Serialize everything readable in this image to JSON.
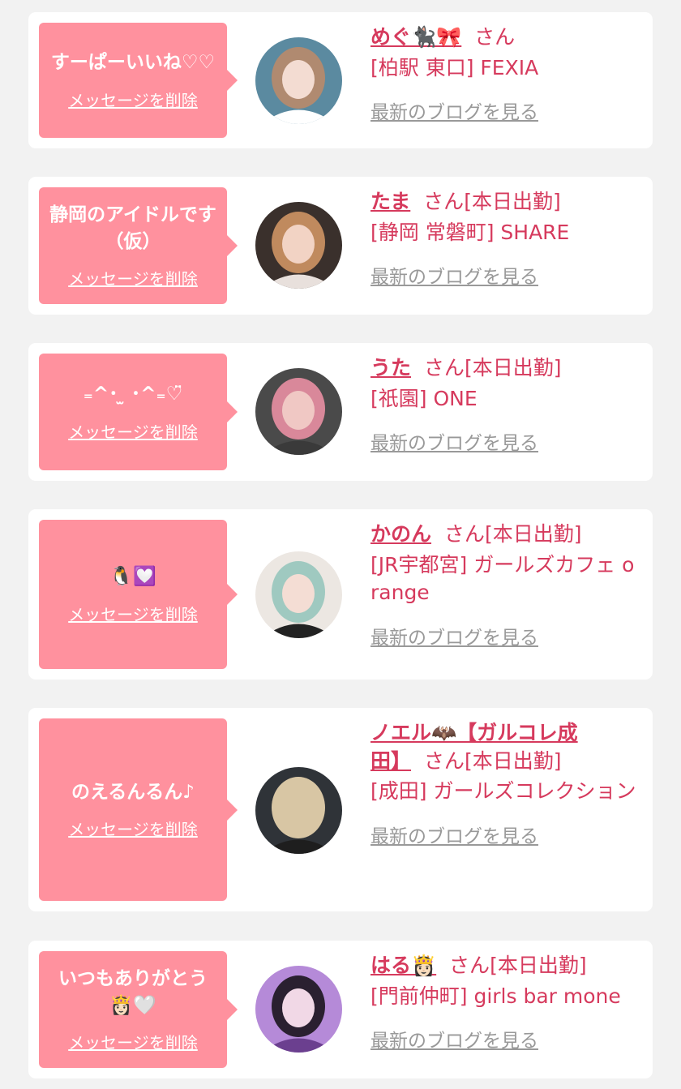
{
  "cards": [
    {
      "message": "すーぱーいいね♡♡",
      "delete_label": "メッセージを削除",
      "name": "めぐ🐈‍⬛🎀",
      "honorific": "さん",
      "status": "",
      "shop": "[柏駅 東口] FEXIA",
      "blog_label": "最新のブログを見る",
      "avatar": {
        "bg": "#5b8aa0",
        "hair": "#b08a70",
        "face": "#f3dcd2",
        "cloth": "#ffffff"
      }
    },
    {
      "message": "静岡のアイドルです（仮）",
      "delete_label": "メッセージを削除",
      "name": "たま",
      "honorific": "さん",
      "status": "[本日出勤]",
      "shop": "[静岡 常磐町] SHARE",
      "blog_label": "最新のブログを見る",
      "avatar": {
        "bg": "#3a302c",
        "hair": "#c08a5e",
        "face": "#f2d3c4",
        "cloth": "#e8e0dc"
      }
    },
    {
      "message": "₌^･ ̫ ･^₌♡̈",
      "delete_label": "メッセージを削除",
      "name": "うた",
      "honorific": "さん",
      "status": "[本日出勤]",
      "shop": "[祇園] ONE",
      "blog_label": "最新のブログを見る",
      "avatar": {
        "bg": "#4a4a4a",
        "hair": "#d9889a",
        "face": "#f0c8c4",
        "cloth": "#3a3a3a"
      }
    },
    {
      "message": "🐧💟",
      "delete_label": "メッセージを削除",
      "name": "かのん",
      "honorific": "さん",
      "status": "[本日出勤]",
      "shop": "[JR宇都宮] ガールズカフェ orange",
      "blog_label": "最新のブログを見る",
      "avatar": {
        "bg": "#ece7e2",
        "hair": "#9fc9c0",
        "face": "#f4ddd4",
        "cloth": "#222222"
      }
    },
    {
      "message": "のえるんるん♪",
      "delete_label": "メッセージを削除",
      "name": "ノエル🦇【ガルコレ成田】",
      "honorific": "さん",
      "status": "[本日出勤]",
      "shop": "[成田] ガールズコレクション",
      "blog_label": "最新のブログを見る",
      "avatar": {
        "bg": "#2f3338",
        "hair": "#d8c6a4",
        "face": "#d8c6a4",
        "cloth": "#1e1e1e"
      }
    },
    {
      "message": "いつもありがとう👸🏻🤍",
      "delete_label": "メッセージを削除",
      "name": "はる👸🏻",
      "honorific": "さん",
      "status": "[本日出勤]",
      "shop": "[門前仲町] girls bar mone",
      "blog_label": "最新のブログを見る",
      "avatar": {
        "bg": "#b58ad8",
        "hair": "#2a2030",
        "face": "#f1d8e6",
        "cloth": "#6b3f8f"
      }
    }
  ]
}
